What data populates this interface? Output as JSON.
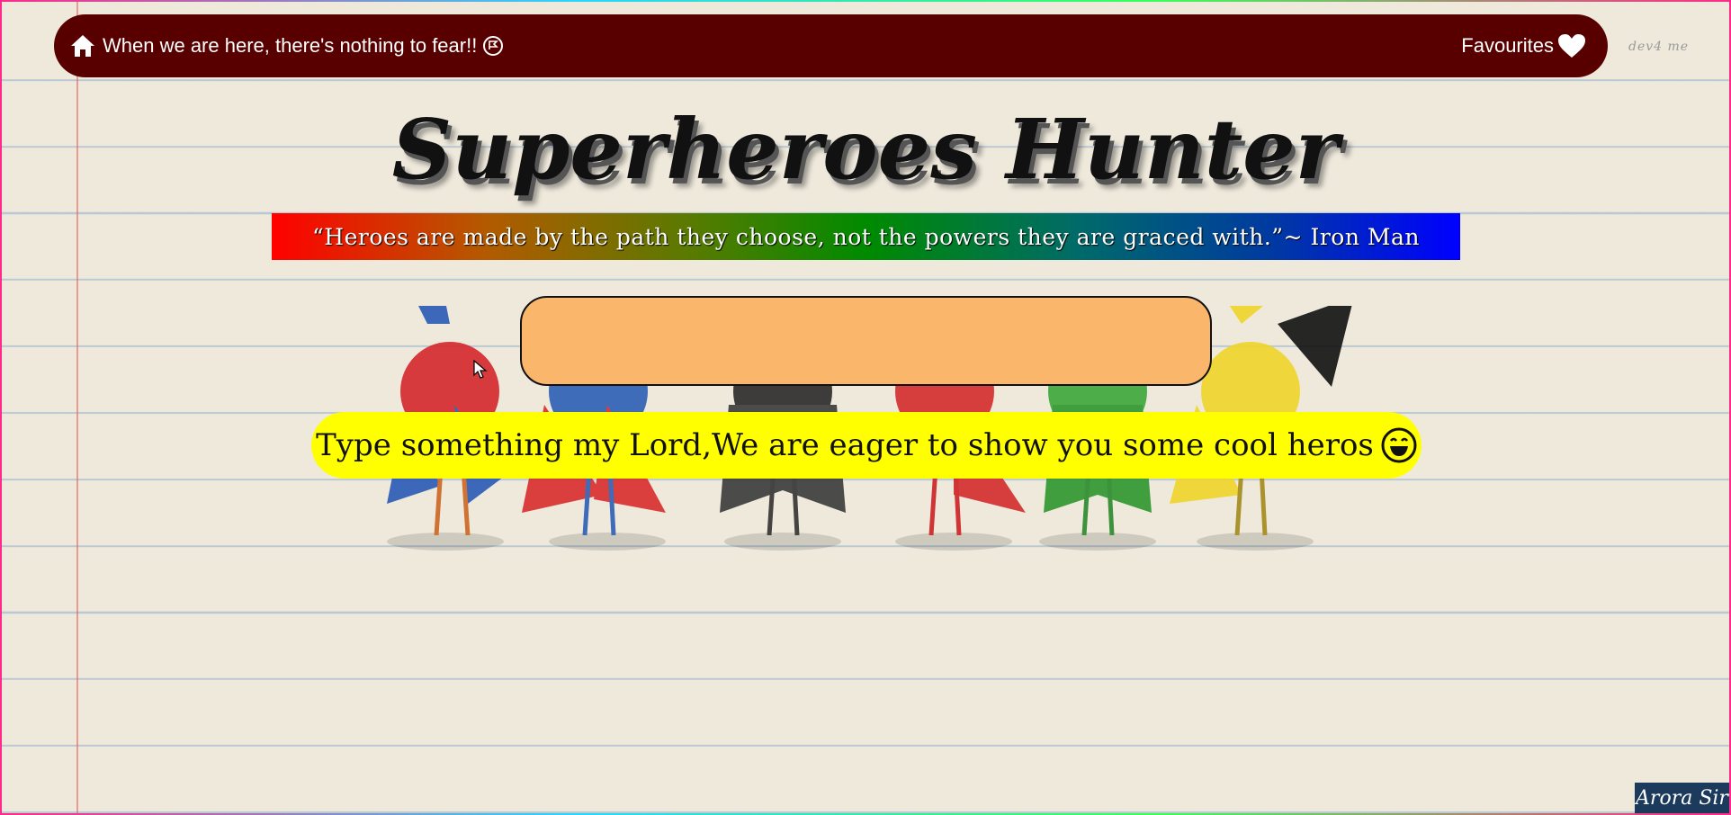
{
  "nav": {
    "home_text": "When we are here, there's nothing to fear!!",
    "favourites_label": "Favourites"
  },
  "signature": "dev4 me",
  "title": "Superheroes Hunter",
  "quote": "“Heroes are made by the path they choose, not the powers they are graced with.”~ Iron Man",
  "search": {
    "value": "",
    "placeholder": ""
  },
  "hint": "Type something my Lord,We are eager to show you some cool heros",
  "badge": "Arora Sir",
  "icons": {
    "home": "home-icon",
    "flag": "flag-icon",
    "heart": "heart-icon",
    "emoji": "smiling-face-icon"
  },
  "colors": {
    "navbar": "#580000",
    "search_bg": "#fab76c",
    "hint_bg": "#ffff00",
    "badge_bg": "#1c3b5c"
  }
}
